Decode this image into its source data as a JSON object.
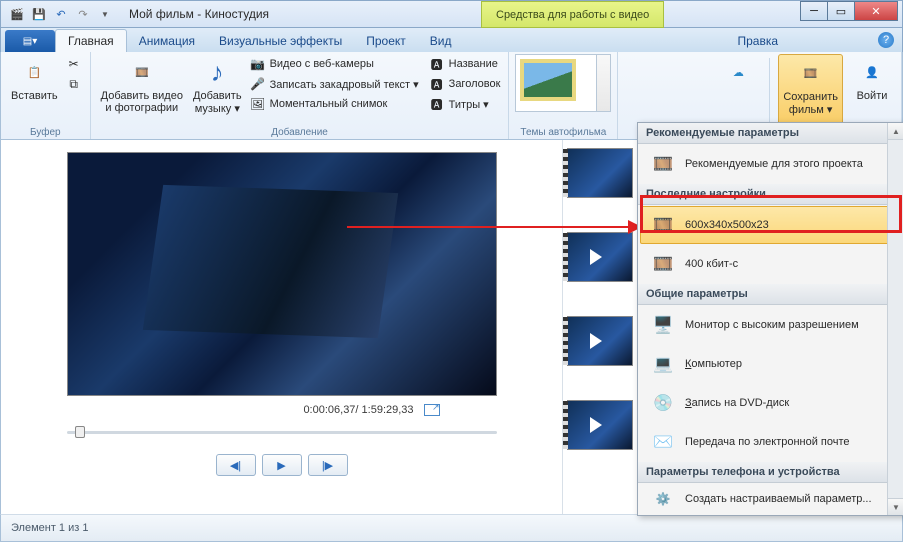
{
  "titlebar": {
    "title": "Мой фильм - Киностудия",
    "contextual": "Средства для работы с видео"
  },
  "tabs": {
    "t0": "Главная",
    "t1": "Анимация",
    "t2": "Визуальные эффекты",
    "t3": "Проект",
    "t4": "Вид",
    "t5": "Правка"
  },
  "ribbon": {
    "grp_clipboard": "Буфер",
    "paste": "Вставить",
    "grp_add": "Добавление",
    "add_video": "Добавить видео\nи фотографии",
    "add_music": "Добавить\nмузыку ▾",
    "webcam": "Видео с веб-камеры",
    "narration": "Записать закадровый текст ▾",
    "snapshot": "Моментальный снимок",
    "title": "Название",
    "caption": "Заголовок",
    "credits": "Титры ▾",
    "grp_themes": "Темы автофильма",
    "save_movie": "Сохранить\nфильм ▾",
    "signin": "Войти"
  },
  "preview": {
    "time": "0:00:06,37/ 1:59:29,33"
  },
  "dropdown": {
    "hdr1": "Рекомендуемые параметры",
    "item1": "Рекомендуемые для этого проекта",
    "hdr2": "Последние настройки",
    "item2": "600x340x500x23",
    "item3": "400 кбит-с",
    "hdr3": "Общие параметры",
    "item4": "Монитор с высоким разрешением",
    "item5": "Компьютер",
    "item6": "Запись на DVD-диск",
    "item7": "Передача по электронной почте",
    "hdr4": "Параметры телефона и устройства",
    "item8": "Создать настраиваемый параметр..."
  },
  "status": {
    "text": "Элемент 1 из 1"
  }
}
